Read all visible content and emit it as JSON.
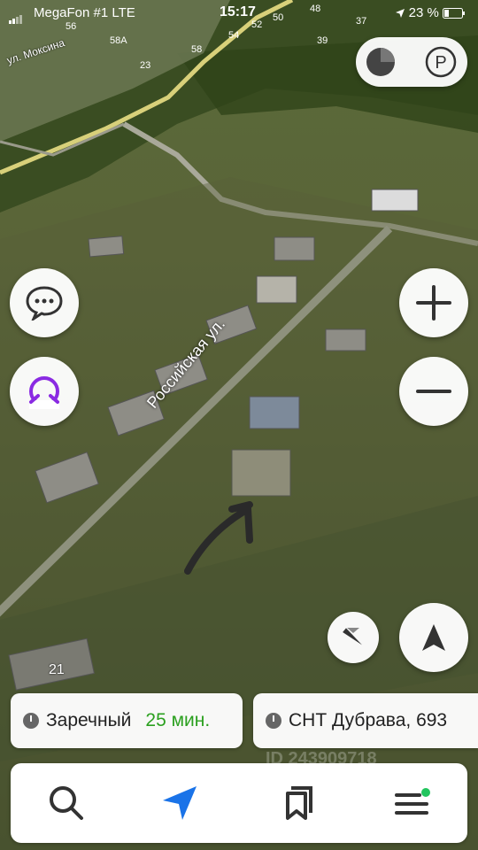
{
  "status_bar": {
    "carrier": "MegaFon #1 LTE",
    "time": "15:17",
    "battery": "23 %"
  },
  "map": {
    "street_label": "Российская ул.",
    "street_label_top": "ул. Моксина",
    "lot_number": "21",
    "house_numbers": [
      "56",
      "58A",
      "58",
      "54",
      "52",
      "50",
      "48",
      "37",
      "39",
      "23"
    ],
    "watermark": "ID 243909718"
  },
  "route_cards": [
    {
      "label": "Заречный",
      "eta": "25 мин."
    },
    {
      "label": "СНТ Дубрава, 693"
    }
  ],
  "tabs": [
    "search",
    "navigator",
    "bookmarks",
    "menu"
  ],
  "colors": {
    "eta": "#2ba01f",
    "accent_blue": "#1a73e8",
    "alice_purple": "#8a2be2",
    "notification": "#22c55e"
  }
}
